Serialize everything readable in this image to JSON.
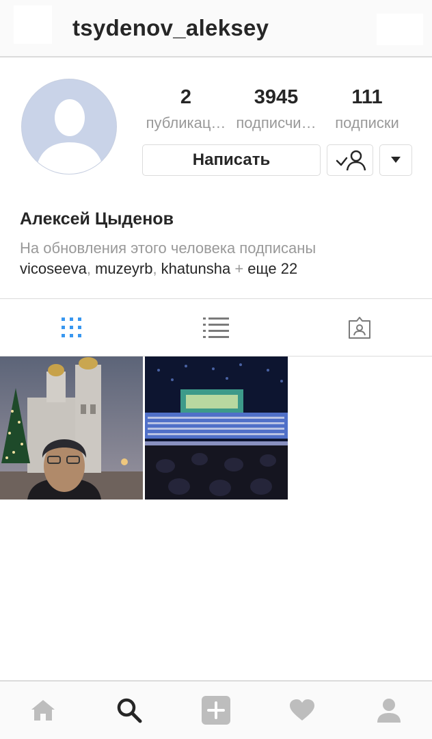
{
  "header": {
    "username": "tsydenov_aleksey"
  },
  "profile": {
    "stats": [
      {
        "value": "2",
        "label": "публикац…"
      },
      {
        "value": "3945",
        "label": "подписчи…"
      },
      {
        "value": "111",
        "label": "подписки"
      }
    ],
    "message_button": "Написать",
    "full_name": "Алексей Цыденов",
    "followed_by_text": "На обновления этого человека подписаны",
    "followed_by": {
      "users": [
        "vicoseeva",
        "muzeyrb",
        "khatunsha"
      ],
      "more": "еще 22"
    }
  },
  "tabs": [
    {
      "icon": "grid-icon",
      "active": true
    },
    {
      "icon": "list-icon",
      "active": false
    },
    {
      "icon": "tagged-icon",
      "active": false
    }
  ],
  "posts": [
    {
      "name": "selfie-kremlin-photo"
    },
    {
      "name": "concert-hall-photo"
    }
  ],
  "bottom_nav": [
    {
      "icon": "home-icon"
    },
    {
      "icon": "search-icon"
    },
    {
      "icon": "add-post-icon"
    },
    {
      "icon": "heart-icon"
    },
    {
      "icon": "profile-icon"
    }
  ],
  "colors": {
    "accent": "#3897f0",
    "muted": "#999999",
    "text": "#262626"
  }
}
